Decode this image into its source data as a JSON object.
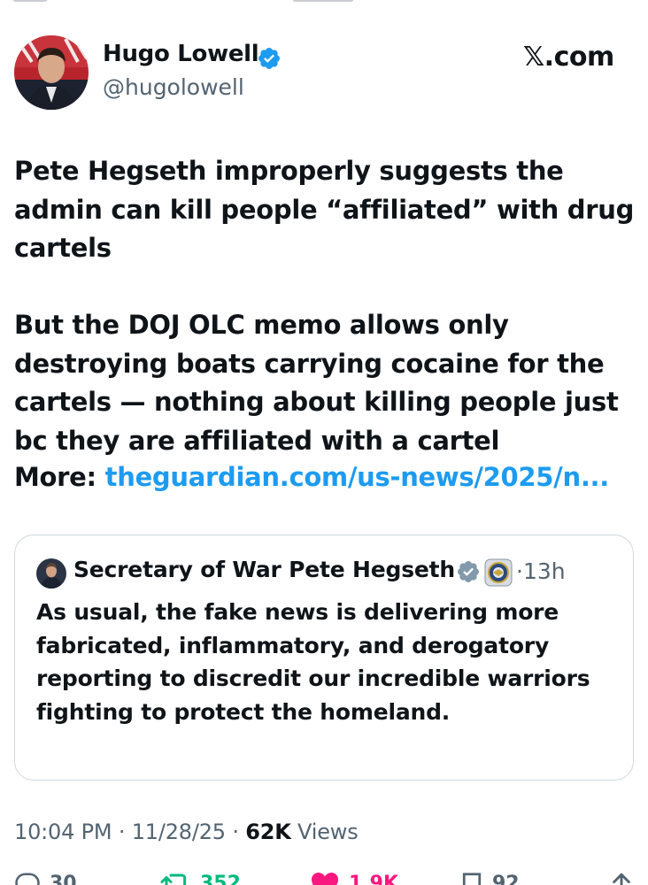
{
  "app": {
    "brand": "𝕏.com"
  },
  "author": {
    "name": "Hugo Lowell",
    "handle": "@hugolowell"
  },
  "tweet": {
    "text": "Pete Hegseth improperly suggests the admin can kill people “affiliated” with drug cartels\n\nBut the DOJ OLC memo allows only destroying boats carrying cocaine for the cartels — nothing about killing people just bc they are affiliated with a cartel",
    "more_label": "More: ",
    "link": "theguardian.com/us-news/2025/n..."
  },
  "quote": {
    "author": "Secretary of War Pete Hegseth",
    "separator": "·",
    "time": "13h",
    "text": "As usual, the fake news is delivering more fabricated, inflammatory, and derogatory reporting to discredit our incredible warriors fighting to protect the homeland."
  },
  "meta": {
    "time": "10:04 PM",
    "date": "11/28/25",
    "views_count": "62K",
    "views_label": "Views",
    "separator": "·"
  },
  "actions": {
    "replies": "30",
    "reposts": "352",
    "likes": "1.9K",
    "bookmarks": "92"
  },
  "colors": {
    "link": "#1d9bf0",
    "verified": "#1d9bf0",
    "quote_verified": "#829aab",
    "repost": "#00ba7c",
    "like": "#f91880",
    "secondary": "#536471",
    "border": "#cfd9de"
  },
  "icons": [
    "verified-badge-icon",
    "dod-seal-icon",
    "reply-icon",
    "repost-icon",
    "like-icon",
    "bookmark-icon",
    "share-icon"
  ]
}
